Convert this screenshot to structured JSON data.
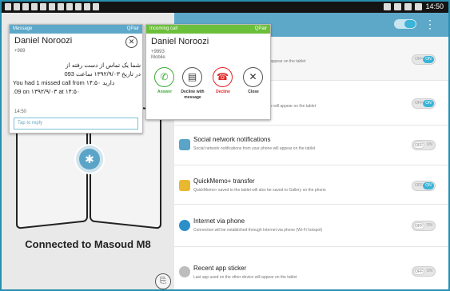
{
  "status_bar": {
    "time": "14:50"
  },
  "left_panel": {
    "connected_text": "Connected to Masoud M8"
  },
  "message_card": {
    "header_label": "Message",
    "header_app": "QPair",
    "sender_name": "Daniel Noroozi",
    "sender_number": "+989",
    "body_lines_rtl": [
      "شما یک تماس از دست رفته از",
      "در تاریخ ۱۳۹۲/۹/۰۳ ساعت 093"
    ],
    "body_line_3": "You had 1 missed call from ۱۴:۵۰ دارید",
    "body_line_4": ".09 on ۱۳۹۲/۹/۰۳ at ۱۴:۵۰",
    "time": "14:50",
    "reply_placeholder": "Tap to reply"
  },
  "call_card": {
    "header_label": "Incoming call",
    "header_app": "QPair",
    "caller_name": "Daniel Noroozi",
    "caller_number": "+9893",
    "caller_type": "Mobile",
    "actions": [
      {
        "label": "Answer",
        "color": "#3aaa35",
        "icon": "phone-answer-icon"
      },
      {
        "label": "Decline with message",
        "color": "#333333",
        "icon": "message-icon"
      },
      {
        "label": "Decline",
        "color": "#e02424",
        "icon": "phone-decline-icon"
      },
      {
        "label": "Close",
        "color": "#333333",
        "icon": "close-icon"
      }
    ]
  },
  "settings": [
    {
      "title": "",
      "desc": "appear on the tablet",
      "toggle": "ON",
      "toggle_off_text": "OFF"
    },
    {
      "title": "",
      "desc": "e will appear on the tablet",
      "toggle": "ON",
      "toggle_off_text": "OFF"
    },
    {
      "title": "Social network notifications",
      "desc": "Social network notifications from your phone will appear on the tablet",
      "toggle": "OFF",
      "toggle_on_text": "ON"
    },
    {
      "title": "QuickMemo+ transfer",
      "desc": "QuickMemo+ saved to the tablet will also be saved to Gallery on the phone",
      "toggle": "ON",
      "toggle_off_text": "OFF"
    },
    {
      "title": "Internet via phone",
      "desc": "Connection will be established through Internet via phone (Wi-Fi hotspot)",
      "toggle": "OFF",
      "toggle_on_text": "ON"
    },
    {
      "title": "Recent app sticker",
      "desc": "Last app used on the other device will appear on the tablet",
      "toggle": "OFF",
      "toggle_on_text": "ON"
    }
  ],
  "colors": {
    "accent": "#5da8c9",
    "call_header": "#6cbf3a",
    "toggle_on": "#3bb4d8"
  }
}
